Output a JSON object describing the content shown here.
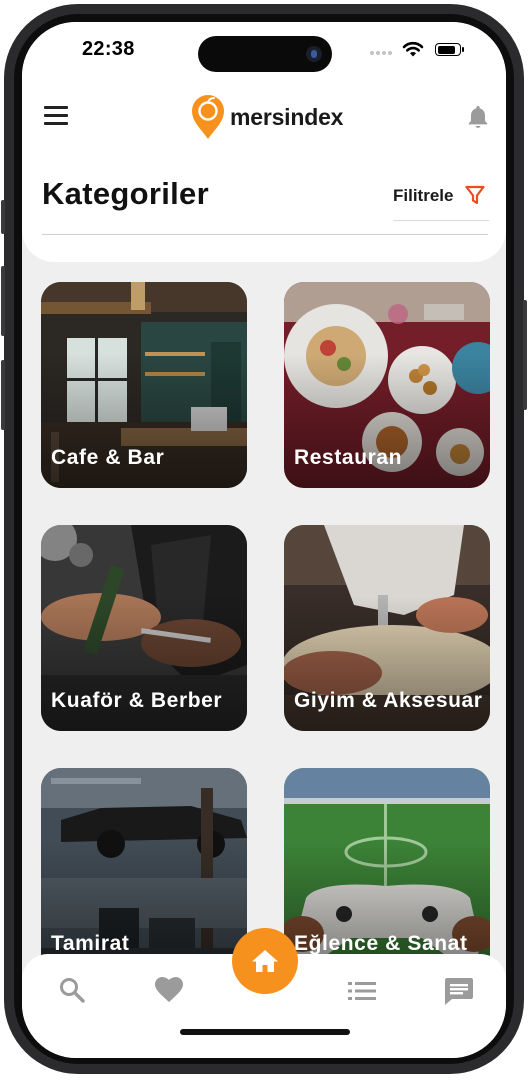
{
  "status_bar": {
    "time": "22:38"
  },
  "header": {
    "brand": "mersindex"
  },
  "page": {
    "title": "Kategoriler",
    "filter_label": "Filitrele"
  },
  "categories": [
    {
      "label": "Cafe & Bar"
    },
    {
      "label": "Restauran"
    },
    {
      "label": "Kuaför & Berber"
    },
    {
      "label": "Giyim & Aksesuar"
    },
    {
      "label": "Tamirat"
    },
    {
      "label": "Eğlence & Sanat"
    }
  ],
  "bottom_nav": [
    {
      "icon": "search-icon"
    },
    {
      "icon": "heart-icon"
    },
    {
      "icon": "home-icon",
      "active": true
    },
    {
      "icon": "list-icon"
    },
    {
      "icon": "chat-icon"
    }
  ],
  "colors": {
    "accent": "#f7911d",
    "filter_icon": "#ee4b1f",
    "nav_icon": "#9b9b9b"
  }
}
